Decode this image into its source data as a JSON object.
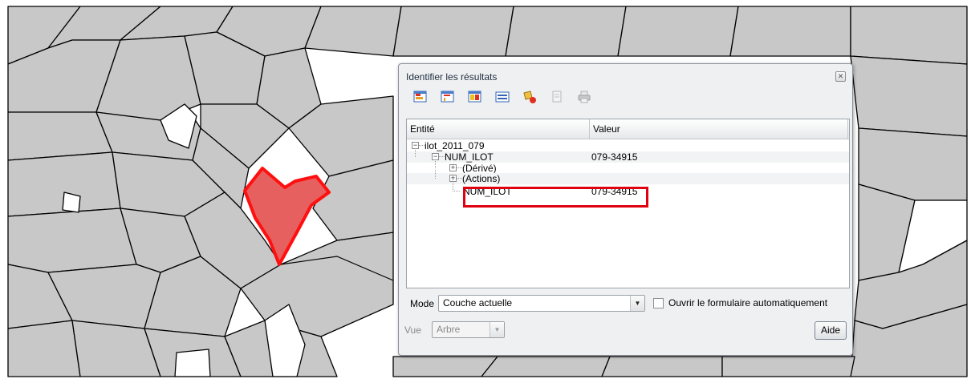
{
  "colors": {
    "parcel_fill": "#c8c8c8",
    "parcel_stroke": "#000000",
    "selected_fill": "#e66060",
    "selected_stroke": "#ff1010",
    "highlight_box": "#e0000f",
    "dialog_bg": "#eef0f2"
  },
  "dialog": {
    "title": "Identifier les résultats",
    "close_icon": "close-icon",
    "toolbar_icons": [
      "expand-tree-icon",
      "collapse-tree-icon",
      "expand-new-results-icon",
      "open-attribute-table-icon",
      "clear-results-icon",
      "copy-feature-icon",
      "print-icon"
    ],
    "columns": {
      "entite": "Entité",
      "valeur": "Valeur"
    },
    "tree": {
      "layer": "ilot_2011_079",
      "feature": {
        "label": "NUM_ILOT",
        "value": "079-34915"
      },
      "derived": "(Dérivé)",
      "actions": "(Actions)",
      "attribute": {
        "label": "NUM_ILOT",
        "value": "079-34915"
      }
    },
    "mode": {
      "label": "Mode",
      "selected": "Couche actuelle"
    },
    "auto_form": {
      "label": "Ouvrir le formulaire automatiquement",
      "checked": false
    },
    "view": {
      "label": "Vue",
      "selected": "Arbre"
    },
    "help_button": "Aide"
  }
}
